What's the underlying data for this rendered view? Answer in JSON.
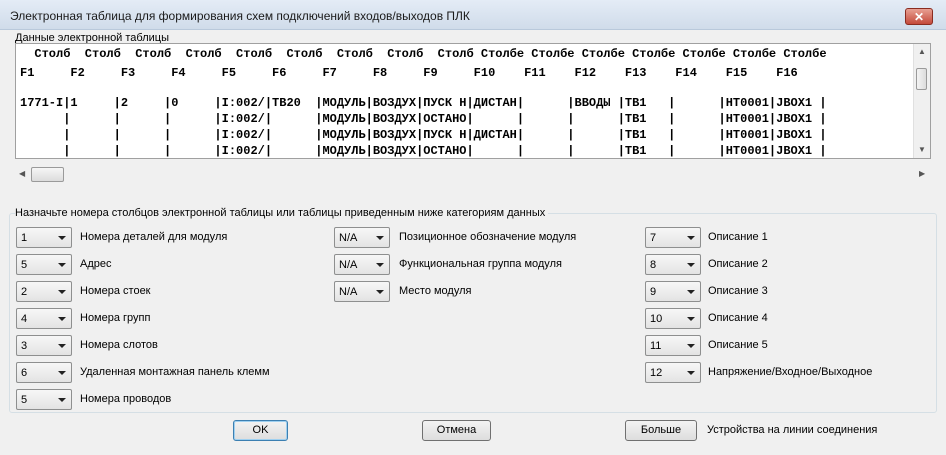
{
  "window": {
    "title": "Электронная таблица для формирования схем подключений входов/выходов ПЛК",
    "close_glyph": "✕"
  },
  "spreadsheet": {
    "label": "Данные электронной таблицы",
    "header_line1": "  Столб  Столб  Столб  Столб  Столб  Столб  Столб  Столб  Столб Столбе Столбе Столбе Столбе Столбе Столбе Столбе",
    "header_line2": "F1     F2     F3     F4     F5     F6     F7     F8     F9     F10    F11    F12    F13    F14    F15    F16",
    "rows": [
      "1771-I|1     |2     |0     |I:002/|TB20  |МОДУЛЬ|ВОЗДУХ|ПУСК Н|ДИСТАН|      |ВВОДЫ |TB1   |      |HT0001|JBOX1 |",
      "      |      |      |      |I:002/|      |МОДУЛЬ|ВОЗДУХ|ОСТАНО|      |      |      |TB1   |      |HT0001|JBOX1 |",
      "      |      |      |      |I:002/|      |МОДУЛЬ|ВОЗДУХ|ПУСК Н|ДИСТАН|      |      |TB1   |      |HT0001|JBOX1 |",
      "      |      |      |      |I:002/|      |МОДУЛЬ|ВОЗДУХ|ОСТАНО|      |      |      |TB1   |      |HT0001|JBOX1 |"
    ]
  },
  "scrollbar": {
    "up_arrow": "▲",
    "down_arrow": "▼",
    "left_arrow": "◀",
    "right_arrow": "▶"
  },
  "assign": {
    "heading": "Назначьте номера столбцов электронной таблицы или таблицы приведенным ниже категориям данных",
    "left": [
      {
        "value": "1",
        "label": "Номера деталей для модуля"
      },
      {
        "value": "5",
        "label": "Адрес"
      },
      {
        "value": "2",
        "label": "Номера стоек"
      },
      {
        "value": "4",
        "label": "Номера групп"
      },
      {
        "value": "3",
        "label": "Номера слотов"
      },
      {
        "value": "6",
        "label": "Удаленная монтажная панель клемм"
      },
      {
        "value": "5",
        "label": "Номера проводов"
      }
    ],
    "middle": [
      {
        "value": "N/A",
        "label": "Позиционное обозначение модуля"
      },
      {
        "value": "N/A",
        "label": "Функциональная группа модуля"
      },
      {
        "value": "N/A",
        "label": "Место модуля"
      }
    ],
    "right": [
      {
        "value": "7",
        "label": "Описание 1"
      },
      {
        "value": "8",
        "label": "Описание 2"
      },
      {
        "value": "9",
        "label": "Описание 3"
      },
      {
        "value": "10",
        "label": "Описание 4"
      },
      {
        "value": "11",
        "label": "Описание 5"
      },
      {
        "value": "12",
        "label": "Напряжение/Входное/Выходное"
      }
    ]
  },
  "buttons": {
    "ok": "OK",
    "cancel": "Отмена",
    "more": "Больше",
    "more_label": "Устройства на линии соединения"
  }
}
